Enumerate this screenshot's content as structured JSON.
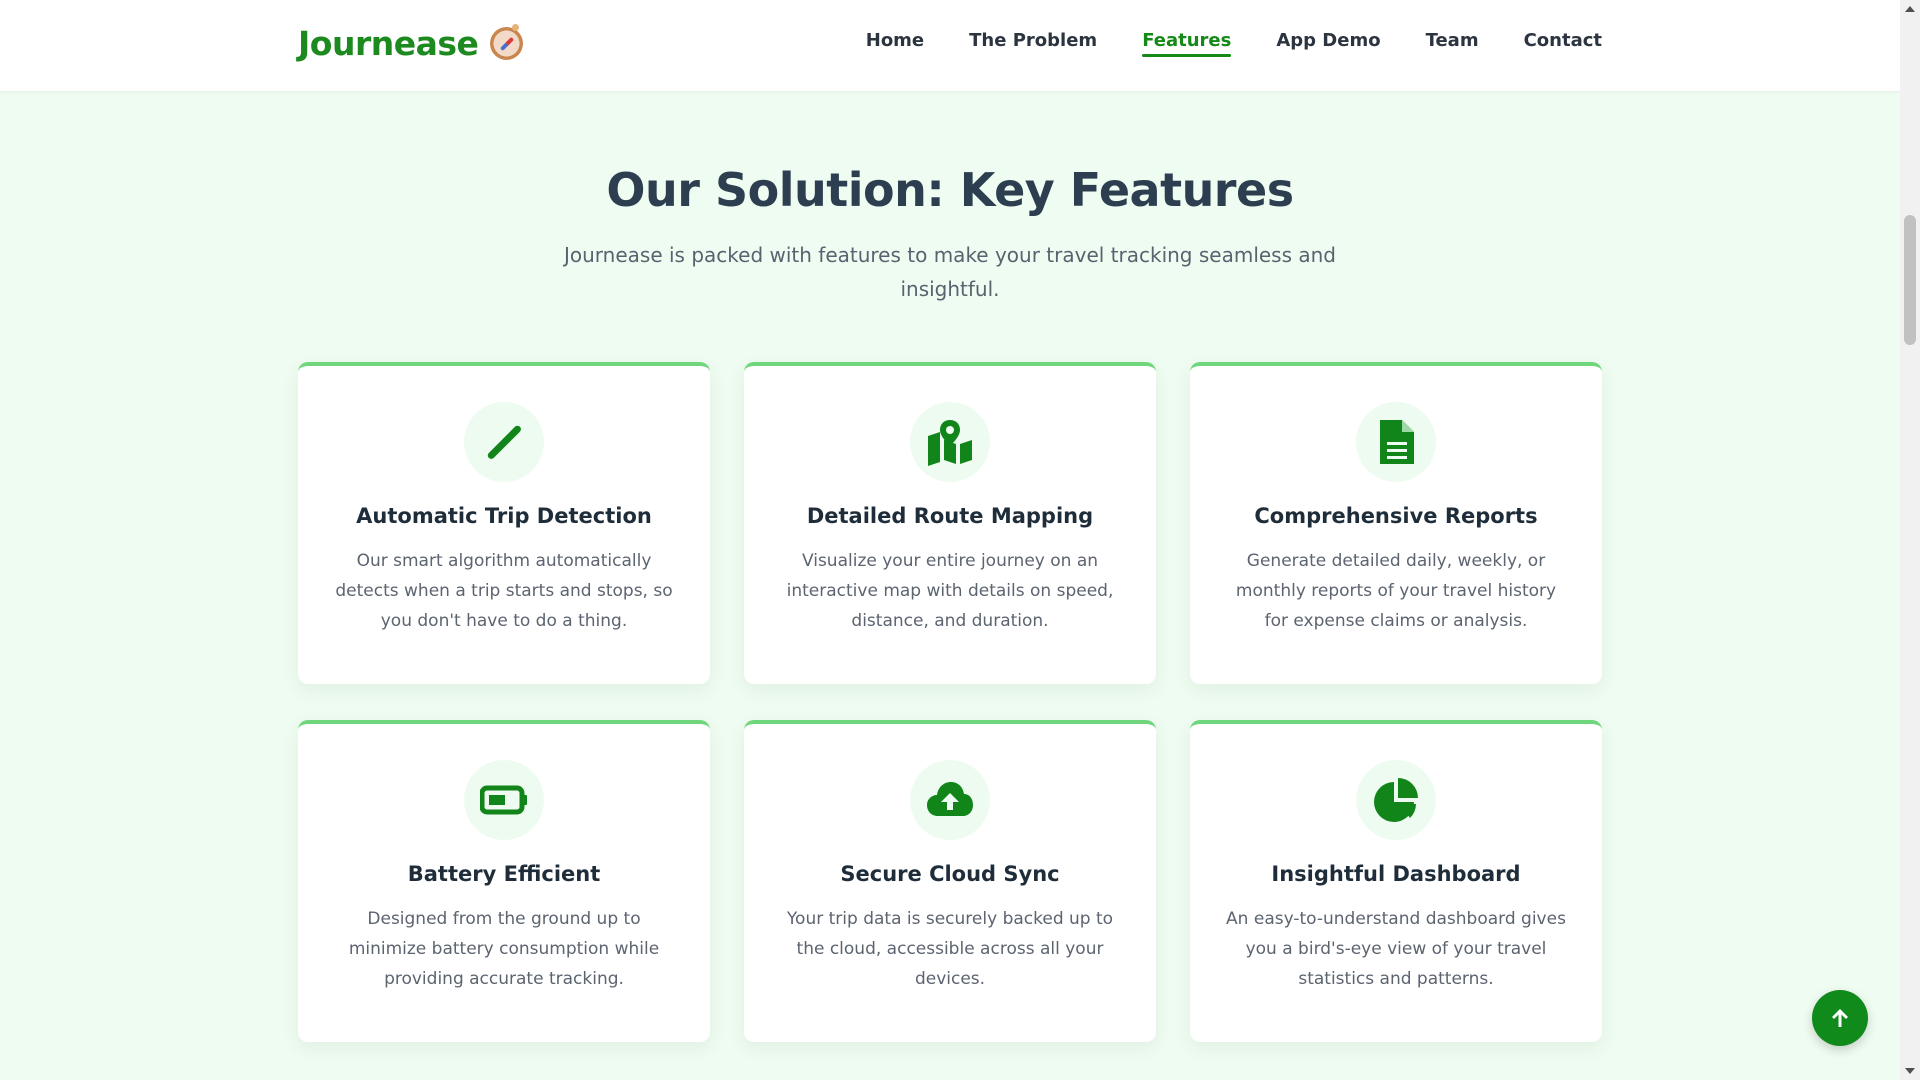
{
  "brand": {
    "name": "Journease",
    "logo_icon": "compass-icon"
  },
  "nav": {
    "items": [
      {
        "label": "Home"
      },
      {
        "label": "The Problem"
      },
      {
        "label": "Features",
        "active": true
      },
      {
        "label": "App Demo"
      },
      {
        "label": "Team"
      },
      {
        "label": "Contact"
      }
    ]
  },
  "features_section": {
    "title": "Our Solution: Key Features",
    "subtitle": "Journease is packed with features to make your travel tracking seamless and insightful.",
    "cards": [
      {
        "icon": "magic-wand-icon",
        "title": "Automatic Trip Detection",
        "description": "Our smart algorithm automatically detects when a trip starts and stops, so you don't have to do a thing."
      },
      {
        "icon": "map-location-icon",
        "title": "Detailed Route Mapping",
        "description": "Visualize your entire journey on an interactive map with details on speed, distance, and duration."
      },
      {
        "icon": "document-icon",
        "title": "Comprehensive Reports",
        "description": "Generate detailed daily, weekly, or monthly reports of your travel history for expense claims or analysis."
      },
      {
        "icon": "battery-icon",
        "title": "Battery Efficient",
        "description": "Designed from the ground up to minimize battery consumption while providing accurate tracking."
      },
      {
        "icon": "cloud-upload-icon",
        "title": "Secure Cloud Sync",
        "description": "Your trip data is securely backed up to the cloud, accessible across all your devices."
      },
      {
        "icon": "pie-chart-icon",
        "title": "Insightful Dashboard",
        "description": "An easy-to-understand dashboard gives you a bird's-eye view of your travel statistics and patterns."
      }
    ]
  },
  "scroll_top": {
    "icon": "arrow-up-icon"
  },
  "colors": {
    "brand_green": "#1d8a1f",
    "accent_green": "#6fd67b",
    "page_bg": "#effcf1",
    "button_green": "#0f8a1b"
  }
}
